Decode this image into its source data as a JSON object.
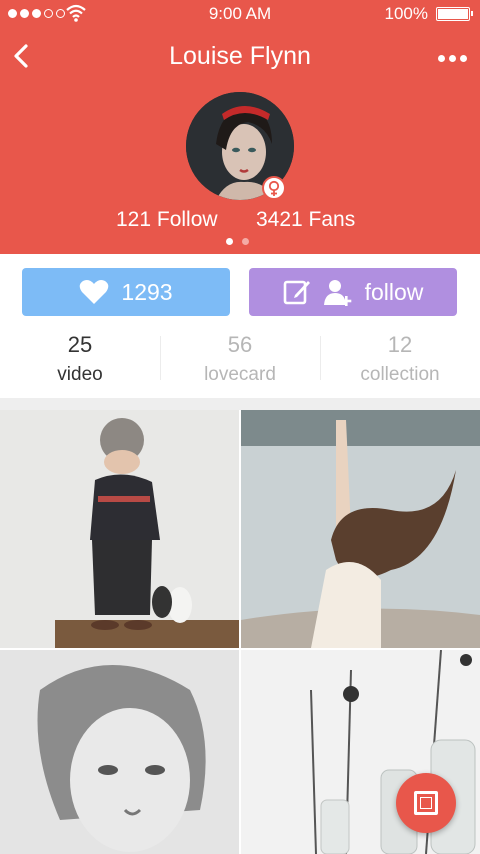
{
  "status_bar": {
    "time": "9:00 AM",
    "battery": "100%"
  },
  "profile": {
    "name": "Louise Flynn",
    "follow_count": "121 Follow",
    "fans_count": "3421 Fans"
  },
  "actions": {
    "like_count": "1293",
    "follow_label": "follow"
  },
  "counts": [
    {
      "number": "25",
      "label": "video"
    },
    {
      "number": "56",
      "label": "lovecard"
    },
    {
      "number": "12",
      "label": "collection"
    }
  ],
  "icons": {
    "back": "chevron-left-icon",
    "more": "more-dots-icon",
    "gender": "female-icon",
    "like": "heart-icon",
    "edit": "edit-icon",
    "add_user": "add-user-icon",
    "fab": "square-icon"
  },
  "colors": {
    "brand": "#e8574b",
    "like_button": "#7dbbf6",
    "follow_button": "#b08fe0"
  }
}
